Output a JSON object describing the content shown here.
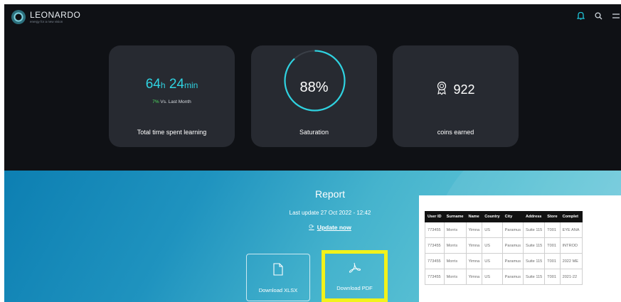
{
  "brand": {
    "name": "LEONARDO",
    "tagline": "energy for a new vision"
  },
  "header": {
    "icons": [
      "bell-icon",
      "search-icon",
      "menu-icon"
    ],
    "accent": "#1fc3d6"
  },
  "cards": {
    "time": {
      "hours": "64",
      "h_unit": "h",
      "minutes": "24",
      "m_unit": "min",
      "pct": "7%",
      "vs": " Vs. Last Month",
      "label": "Total time spent learning"
    },
    "saturation": {
      "value": "88%",
      "progress": 0.88,
      "label": "Saturation"
    },
    "coins": {
      "value": "922",
      "icon": "medal-icon",
      "label": "coins earned"
    }
  },
  "report": {
    "title": "Report",
    "last_update": "Last update 27 Oct 2022 - 12:42",
    "update_now": "Update now",
    "buttons": {
      "xlsx": "Download XLSX",
      "pdf": "Download PDF"
    },
    "highlight_color": "#f2f21a"
  },
  "table": {
    "headers": [
      "User ID",
      "Surname",
      "Name",
      "Country",
      "City",
      "Address",
      "Store",
      "Complet"
    ],
    "rows": [
      [
        "773455",
        "Morris",
        "Yimna",
        "US",
        "Paramus",
        "Suite 115",
        "T001",
        "EYE ANA"
      ],
      [
        "773455",
        "Morris",
        "Yimna",
        "US",
        "Paramus",
        "Suite 115",
        "T001",
        "INTROD"
      ],
      [
        "773455",
        "Morris",
        "Yimna",
        "US",
        "Paramus",
        "Suite 115",
        "T001",
        "2022 ME"
      ],
      [
        "773455",
        "Morris",
        "Yimna",
        "US",
        "Paramus",
        "Suite 115",
        "T001",
        "2021-22"
      ]
    ]
  }
}
